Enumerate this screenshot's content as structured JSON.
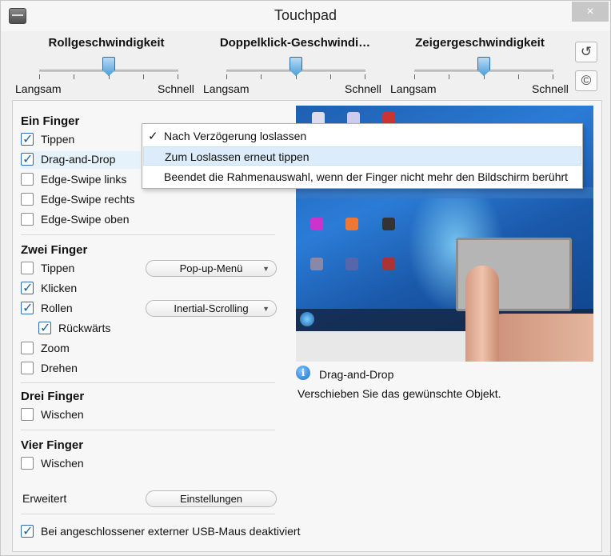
{
  "window": {
    "title": "Touchpad",
    "close_icon": "×"
  },
  "sliders": [
    {
      "title": "Rollgeschwindigkeit",
      "low": "Langsam",
      "high": "Schnell",
      "level": 0.5
    },
    {
      "title": "Doppelklick-Geschwindi…",
      "low": "Langsam",
      "high": "Schnell",
      "level": 0.5
    },
    {
      "title": "Zeigergeschwindigkeit",
      "low": "Langsam",
      "high": "Schnell",
      "level": 0.5
    }
  ],
  "side_buttons": {
    "reset_icon": "↺",
    "copyright_icon": "©"
  },
  "sections": {
    "one_finger": {
      "title": "Ein Finger",
      "items": [
        {
          "label": "Tippen",
          "checked": true
        },
        {
          "label": "Drag-and-Drop",
          "checked": true
        },
        {
          "label": "Edge-Swipe links",
          "checked": false
        },
        {
          "label": "Edge-Swipe rechts",
          "checked": false
        },
        {
          "label": "Edge-Swipe oben",
          "checked": false
        }
      ]
    },
    "two_finger": {
      "title": "Zwei Finger",
      "items": [
        {
          "label": "Tippen",
          "checked": false
        },
        {
          "label": "Klicken",
          "checked": true
        },
        {
          "label": "Rollen",
          "checked": true
        },
        {
          "label": "Rückwärts",
          "checked": true
        },
        {
          "label": "Zoom",
          "checked": false
        },
        {
          "label": "Drehen",
          "checked": false
        }
      ],
      "tap_combo": "Pop-up-Menü",
      "scroll_combo": "Inertial-Scrolling"
    },
    "three_finger": {
      "title": "Drei Finger",
      "items": [
        {
          "label": "Wischen",
          "checked": false
        }
      ]
    },
    "four_finger": {
      "title": "Vier Finger",
      "items": [
        {
          "label": "Wischen",
          "checked": false
        }
      ]
    }
  },
  "advanced": {
    "label": "Erweitert",
    "button": "Einstellungen"
  },
  "usb_mouse": {
    "label": "Bei angeschlossener externer USB-Maus deaktiviert",
    "checked": true
  },
  "info": {
    "icon": "i",
    "title": "Drag-and-Drop",
    "description": "Verschieben Sie das gewünschte Objekt."
  },
  "dropdown_menu": {
    "items": [
      {
        "label": "Nach Verzögerung loslassen",
        "checked": true
      },
      {
        "label": "Zum Loslassen erneut tippen",
        "checked": false,
        "hovered": true
      },
      {
        "label": "Beendet die Rahmenauswahl, wenn der Finger nicht mehr den Bildschirm berührt",
        "checked": false
      }
    ],
    "check_mark": "✓"
  },
  "colors": {
    "accent": "#2b6db0",
    "menu_hover": "#dcecfb"
  }
}
